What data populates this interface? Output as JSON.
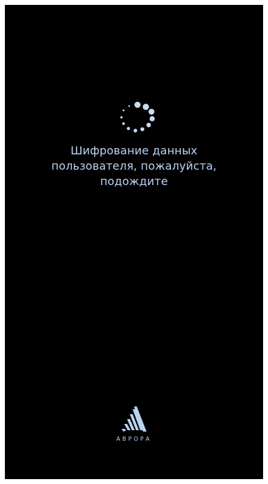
{
  "screen": {
    "message": "Шифрование данных\nпользователя, пожалуйста,\nподождите",
    "brand_name": "АВРОРА",
    "background_color": "#000000",
    "accent_color": "#b9d3f2"
  },
  "spinner": {
    "icon": "loading-spinner-icon"
  },
  "logo": {
    "icon": "aurora-logo-icon"
  }
}
